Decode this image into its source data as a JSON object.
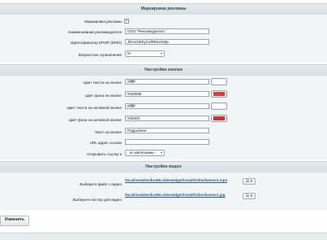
{
  "sections": {
    "ad_marking": "Маркировка рекламы",
    "button_settings": "Настройки кнопки",
    "video_settings": "Настройки видео"
  },
  "ad": {
    "marking_label": "Маркировка рекламы",
    "marking_checked": true,
    "advertiser_label": "Наименование рекламодателя",
    "advertiser_value": "ООО \"Рекламодатель\"",
    "erid_label": "Идентификатор ЕРИР (ERID)",
    "erid_value": "JRx1O2tEyCefRB1eSWp",
    "age_label": "Возрастное ограничение",
    "age_value": "6+"
  },
  "button": {
    "text_color_label": "Цвет текста на кнопке",
    "text_color_value": "#ffffff",
    "text_color_swatch": "#ffffff",
    "bg_color_label": "Цвет фона на кнопке",
    "bg_color_value": "#e53935",
    "bg_color_swatch": "#e53935",
    "active_text_color_label": "Цвет текста на активной кнопке",
    "active_text_color_value": "#ffffff",
    "active_text_color_swatch": "#ffffff",
    "active_bg_color_label": "Цвет фона на активной кнопке",
    "active_bg_color_value": "#d32f2f",
    "active_bg_color_swatch": "#d32f2f",
    "text_label": "Текст на кнопке",
    "text_value": "Подробнее",
    "url_label": "URL адрес ссылки",
    "url_value": "",
    "open_label": "Открывать ссылку в",
    "open_value": "- по умолчанию -"
  },
  "video": {
    "file_label": "Выберите файл с видео",
    "file_path": "/local/modules/bx365.videowidget/install/video/banner1.mp4",
    "poster_label": "Выберите постер для видео",
    "poster_path": "/local/modules/bx365.videowidget/install/video/banner1.jpg",
    "menu_glyph": "☰ ▾"
  },
  "save_label": "Изменить"
}
